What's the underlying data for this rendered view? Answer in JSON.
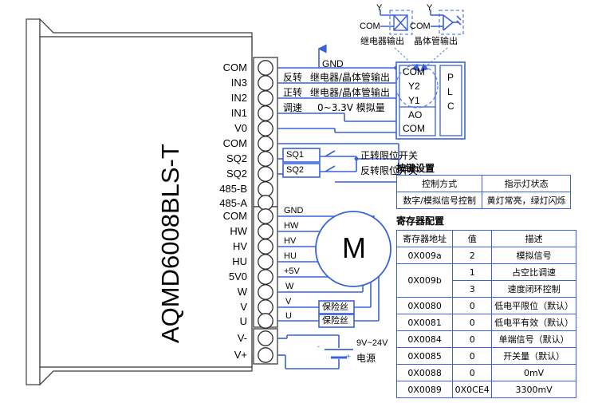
{
  "device": {
    "model": "AQMD6008BLS-T",
    "terminals_group1": [
      "COM",
      "IN3",
      "IN2",
      "IN1",
      "V0",
      "COM",
      "SQ2",
      "SQ2",
      "485-B",
      "485-A"
    ],
    "terminals_group2": [
      "COM",
      "HW",
      "HV",
      "HU",
      "5V0",
      "W",
      "V",
      "U"
    ],
    "terminals_group3": [
      "V-",
      "V+"
    ]
  },
  "wiring": {
    "gnd_label": "GND",
    "signal_rows": [
      {
        "name": "反转",
        "desc": "继电器/晶体管输出"
      },
      {
        "name": "正转",
        "desc": "继电器/晶体管输出"
      },
      {
        "name": "调速",
        "desc": "0~3.3V  模拟量"
      }
    ],
    "limit_switches": [
      {
        "tag": "SQ1",
        "desc": "正转限位开关"
      },
      {
        "tag": "SQ2",
        "desc": "反转限位开关"
      }
    ],
    "motor_labels": [
      "GND",
      "HW",
      "HV",
      "HU",
      "+5V",
      "W",
      "V",
      "U"
    ],
    "motor_symbol": "M",
    "fuse_label": "保险丝",
    "power_voltage": "9V~24V",
    "power_label": "电源",
    "power_minus": "-",
    "power_plus": "+"
  },
  "plc": {
    "label_letters": [
      "P",
      "L",
      "C"
    ],
    "terminals": [
      "COM",
      "Y2",
      "Y1",
      "AO",
      "COM"
    ],
    "output_types": [
      {
        "y": "Y",
        "com": "COM",
        "caption": "继电器输出"
      },
      {
        "y": "Y",
        "com": "COM",
        "caption": "晶体管输出"
      }
    ]
  },
  "key_settings": {
    "title": "按键设置",
    "headers": [
      "控制方式",
      "指示灯状态"
    ],
    "rows": [
      [
        "数字/模拟信号控制",
        "黄灯常亮，绿灯闪烁"
      ]
    ]
  },
  "register_config": {
    "title": "寄存器配置",
    "headers": [
      "寄存器地址",
      "值",
      "描述"
    ],
    "rows": [
      {
        "address": "0X009a",
        "value": "2",
        "desc": "模拟信号",
        "rowspan": 1
      },
      {
        "address": "0X009b",
        "value": "1",
        "desc": "占空比调速",
        "rowspan": 2
      },
      {
        "address": "",
        "value": "3",
        "desc": "速度闭环控制",
        "rowspan": 0
      },
      {
        "address": "0X0080",
        "value": "0",
        "desc": "低电平限位（默认）",
        "rowspan": 1
      },
      {
        "address": "0X0081",
        "value": "0",
        "desc": "低电平有效（默认）",
        "rowspan": 1
      },
      {
        "address": "0X0084",
        "value": "0",
        "desc": "单端信号（默认）",
        "rowspan": 1
      },
      {
        "address": "0X0085",
        "value": "0",
        "desc": "开关量（默认）",
        "rowspan": 1
      },
      {
        "address": "0X0088",
        "value": "0",
        "desc": "0mV",
        "rowspan": 1
      },
      {
        "address": "0X0089",
        "value": "0X0CE4",
        "desc": "3300mV",
        "rowspan": 1
      }
    ]
  },
  "colors": {
    "wire": "#3a62d8",
    "outline": "#000000",
    "table_border": "#3a62d8",
    "device_fill": "#ffffff"
  }
}
